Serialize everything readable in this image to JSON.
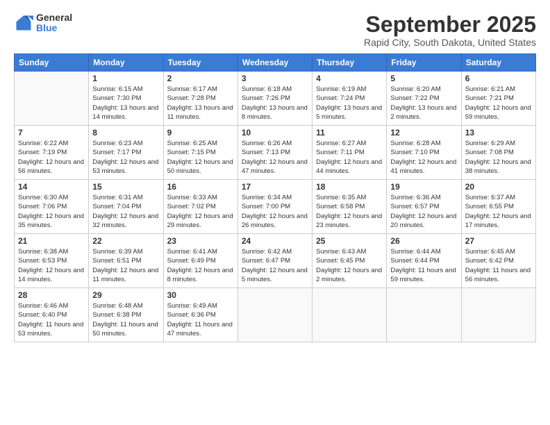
{
  "logo": {
    "general": "General",
    "blue": "Blue"
  },
  "title": "September 2025",
  "location": "Rapid City, South Dakota, United States",
  "weekdays": [
    "Sunday",
    "Monday",
    "Tuesday",
    "Wednesday",
    "Thursday",
    "Friday",
    "Saturday"
  ],
  "weeks": [
    [
      {
        "day": "",
        "sunrise": "",
        "sunset": "",
        "daylight": ""
      },
      {
        "day": "1",
        "sunrise": "Sunrise: 6:15 AM",
        "sunset": "Sunset: 7:30 PM",
        "daylight": "Daylight: 13 hours and 14 minutes."
      },
      {
        "day": "2",
        "sunrise": "Sunrise: 6:17 AM",
        "sunset": "Sunset: 7:28 PM",
        "daylight": "Daylight: 13 hours and 11 minutes."
      },
      {
        "day": "3",
        "sunrise": "Sunrise: 6:18 AM",
        "sunset": "Sunset: 7:26 PM",
        "daylight": "Daylight: 13 hours and 8 minutes."
      },
      {
        "day": "4",
        "sunrise": "Sunrise: 6:19 AM",
        "sunset": "Sunset: 7:24 PM",
        "daylight": "Daylight: 13 hours and 5 minutes."
      },
      {
        "day": "5",
        "sunrise": "Sunrise: 6:20 AM",
        "sunset": "Sunset: 7:22 PM",
        "daylight": "Daylight: 13 hours and 2 minutes."
      },
      {
        "day": "6",
        "sunrise": "Sunrise: 6:21 AM",
        "sunset": "Sunset: 7:21 PM",
        "daylight": "Daylight: 12 hours and 59 minutes."
      }
    ],
    [
      {
        "day": "7",
        "sunrise": "Sunrise: 6:22 AM",
        "sunset": "Sunset: 7:19 PM",
        "daylight": "Daylight: 12 hours and 56 minutes."
      },
      {
        "day": "8",
        "sunrise": "Sunrise: 6:23 AM",
        "sunset": "Sunset: 7:17 PM",
        "daylight": "Daylight: 12 hours and 53 minutes."
      },
      {
        "day": "9",
        "sunrise": "Sunrise: 6:25 AM",
        "sunset": "Sunset: 7:15 PM",
        "daylight": "Daylight: 12 hours and 50 minutes."
      },
      {
        "day": "10",
        "sunrise": "Sunrise: 6:26 AM",
        "sunset": "Sunset: 7:13 PM",
        "daylight": "Daylight: 12 hours and 47 minutes."
      },
      {
        "day": "11",
        "sunrise": "Sunrise: 6:27 AM",
        "sunset": "Sunset: 7:11 PM",
        "daylight": "Daylight: 12 hours and 44 minutes."
      },
      {
        "day": "12",
        "sunrise": "Sunrise: 6:28 AM",
        "sunset": "Sunset: 7:10 PM",
        "daylight": "Daylight: 12 hours and 41 minutes."
      },
      {
        "day": "13",
        "sunrise": "Sunrise: 6:29 AM",
        "sunset": "Sunset: 7:08 PM",
        "daylight": "Daylight: 12 hours and 38 minutes."
      }
    ],
    [
      {
        "day": "14",
        "sunrise": "Sunrise: 6:30 AM",
        "sunset": "Sunset: 7:06 PM",
        "daylight": "Daylight: 12 hours and 35 minutes."
      },
      {
        "day": "15",
        "sunrise": "Sunrise: 6:31 AM",
        "sunset": "Sunset: 7:04 PM",
        "daylight": "Daylight: 12 hours and 32 minutes."
      },
      {
        "day": "16",
        "sunrise": "Sunrise: 6:33 AM",
        "sunset": "Sunset: 7:02 PM",
        "daylight": "Daylight: 12 hours and 29 minutes."
      },
      {
        "day": "17",
        "sunrise": "Sunrise: 6:34 AM",
        "sunset": "Sunset: 7:00 PM",
        "daylight": "Daylight: 12 hours and 26 minutes."
      },
      {
        "day": "18",
        "sunrise": "Sunrise: 6:35 AM",
        "sunset": "Sunset: 6:58 PM",
        "daylight": "Daylight: 12 hours and 23 minutes."
      },
      {
        "day": "19",
        "sunrise": "Sunrise: 6:36 AM",
        "sunset": "Sunset: 6:57 PM",
        "daylight": "Daylight: 12 hours and 20 minutes."
      },
      {
        "day": "20",
        "sunrise": "Sunrise: 6:37 AM",
        "sunset": "Sunset: 6:55 PM",
        "daylight": "Daylight: 12 hours and 17 minutes."
      }
    ],
    [
      {
        "day": "21",
        "sunrise": "Sunrise: 6:38 AM",
        "sunset": "Sunset: 6:53 PM",
        "daylight": "Daylight: 12 hours and 14 minutes."
      },
      {
        "day": "22",
        "sunrise": "Sunrise: 6:39 AM",
        "sunset": "Sunset: 6:51 PM",
        "daylight": "Daylight: 12 hours and 11 minutes."
      },
      {
        "day": "23",
        "sunrise": "Sunrise: 6:41 AM",
        "sunset": "Sunset: 6:49 PM",
        "daylight": "Daylight: 12 hours and 8 minutes."
      },
      {
        "day": "24",
        "sunrise": "Sunrise: 6:42 AM",
        "sunset": "Sunset: 6:47 PM",
        "daylight": "Daylight: 12 hours and 5 minutes."
      },
      {
        "day": "25",
        "sunrise": "Sunrise: 6:43 AM",
        "sunset": "Sunset: 6:45 PM",
        "daylight": "Daylight: 12 hours and 2 minutes."
      },
      {
        "day": "26",
        "sunrise": "Sunrise: 6:44 AM",
        "sunset": "Sunset: 6:44 PM",
        "daylight": "Daylight: 11 hours and 59 minutes."
      },
      {
        "day": "27",
        "sunrise": "Sunrise: 6:45 AM",
        "sunset": "Sunset: 6:42 PM",
        "daylight": "Daylight: 11 hours and 56 minutes."
      }
    ],
    [
      {
        "day": "28",
        "sunrise": "Sunrise: 6:46 AM",
        "sunset": "Sunset: 6:40 PM",
        "daylight": "Daylight: 11 hours and 53 minutes."
      },
      {
        "day": "29",
        "sunrise": "Sunrise: 6:48 AM",
        "sunset": "Sunset: 6:38 PM",
        "daylight": "Daylight: 11 hours and 50 minutes."
      },
      {
        "day": "30",
        "sunrise": "Sunrise: 6:49 AM",
        "sunset": "Sunset: 6:36 PM",
        "daylight": "Daylight: 11 hours and 47 minutes."
      },
      {
        "day": "",
        "sunrise": "",
        "sunset": "",
        "daylight": ""
      },
      {
        "day": "",
        "sunrise": "",
        "sunset": "",
        "daylight": ""
      },
      {
        "day": "",
        "sunrise": "",
        "sunset": "",
        "daylight": ""
      },
      {
        "day": "",
        "sunrise": "",
        "sunset": "",
        "daylight": ""
      }
    ]
  ]
}
